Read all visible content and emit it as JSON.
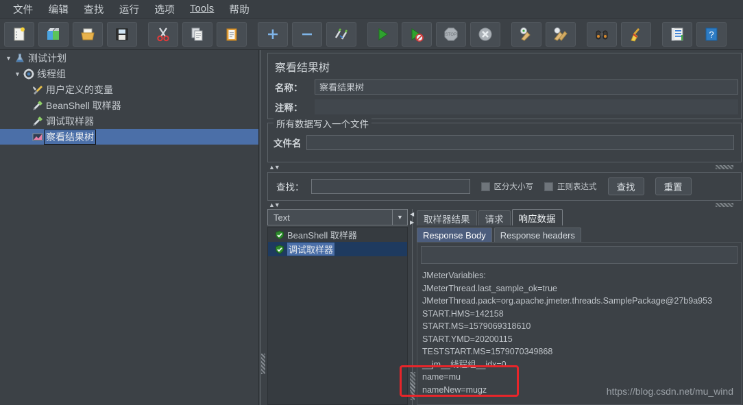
{
  "menu": {
    "items": [
      {
        "label": "文件",
        "underlined": false
      },
      {
        "label": "编辑",
        "underlined": false
      },
      {
        "label": "查找",
        "underlined": false
      },
      {
        "label": "运行",
        "underlined": false
      },
      {
        "label": "选项",
        "underlined": false
      },
      {
        "label": "Tools",
        "underlined": true
      },
      {
        "label": "帮助",
        "underlined": false
      }
    ]
  },
  "toolbar": {
    "buttons": [
      {
        "name": "new-icon"
      },
      {
        "name": "templates-icon"
      },
      {
        "name": "open-icon"
      },
      {
        "name": "save-icon"
      },
      {
        "name": "cut-icon"
      },
      {
        "name": "copy-icon"
      },
      {
        "name": "paste-icon"
      },
      {
        "name": "expand-all-icon"
      },
      {
        "name": "collapse-all-icon"
      },
      {
        "name": "toggle-icon"
      },
      {
        "name": "start-icon"
      },
      {
        "name": "start-no-pauses-icon"
      },
      {
        "name": "stop-icon"
      },
      {
        "name": "shutdown-icon"
      },
      {
        "name": "clear-icon"
      },
      {
        "name": "clear-all-icon"
      },
      {
        "name": "search-icon"
      },
      {
        "name": "reset-search-icon"
      },
      {
        "name": "function-helper-icon"
      },
      {
        "name": "help-icon"
      }
    ]
  },
  "tree": {
    "nodes": [
      {
        "label": "测试计划",
        "indent": 0,
        "twist": "▼",
        "icon": "test-plan-icon",
        "selected": false
      },
      {
        "label": "线程组",
        "indent": 1,
        "twist": "▼",
        "icon": "thread-group-icon",
        "selected": false
      },
      {
        "label": "用户定义的变量",
        "indent": 2,
        "twist": "",
        "icon": "config-element-icon",
        "selected": false
      },
      {
        "label": "BeanShell 取样器",
        "indent": 2,
        "twist": "",
        "icon": "sampler-icon",
        "selected": false
      },
      {
        "label": "调试取样器",
        "indent": 2,
        "twist": "",
        "icon": "sampler-icon",
        "selected": false
      },
      {
        "label": "察看结果树",
        "indent": 2,
        "twist": "",
        "icon": "view-results-tree-icon",
        "selected": true
      }
    ]
  },
  "panel": {
    "title": "察看结果树",
    "name_label": "名称：",
    "name_value": "察看结果树",
    "comment_label": "注释：",
    "comment_value": "",
    "filegroup": {
      "legend": "所有数据写入一个文件",
      "filename_label": "文件名",
      "filename_value": ""
    }
  },
  "search": {
    "label": "查找：",
    "value": "",
    "case_sensitive_label": "区分大小写",
    "case_sensitive_checked": false,
    "regex_label": "正则表达式",
    "regex_checked": false,
    "find_button": "查找",
    "reset_button": "重置"
  },
  "results": {
    "renderer_selected": "Text",
    "samplers": [
      {
        "label": "BeanShell 取样器",
        "status": "success",
        "selected": false
      },
      {
        "label": "调试取样器",
        "status": "success",
        "selected": true
      }
    ],
    "tabs": [
      {
        "label": "取样器结果",
        "active": false
      },
      {
        "label": "请求",
        "active": false
      },
      {
        "label": "响应数据",
        "active": true
      }
    ],
    "subtabs": [
      {
        "label": "Response Body",
        "active": true
      },
      {
        "label": "Response headers",
        "active": false
      }
    ],
    "body_filter_value": "",
    "body_lines": [
      "JMeterVariables:",
      "JMeterThread.last_sample_ok=true",
      "JMeterThread.pack=org.apache.jmeter.threads.SamplePackage@27b9a953",
      "START.HMS=142158",
      "START.MS=1579069318610",
      "START.YMD=20200115",
      "TESTSTART.MS=1579070349868",
      "__jm__线程组__idx=0",
      "name=mu",
      "nameNew=mugz"
    ]
  },
  "annotation": {
    "highlight_color": "#e8252a"
  },
  "watermark": {
    "text": "https://blog.csdn.net/mu_wind"
  }
}
